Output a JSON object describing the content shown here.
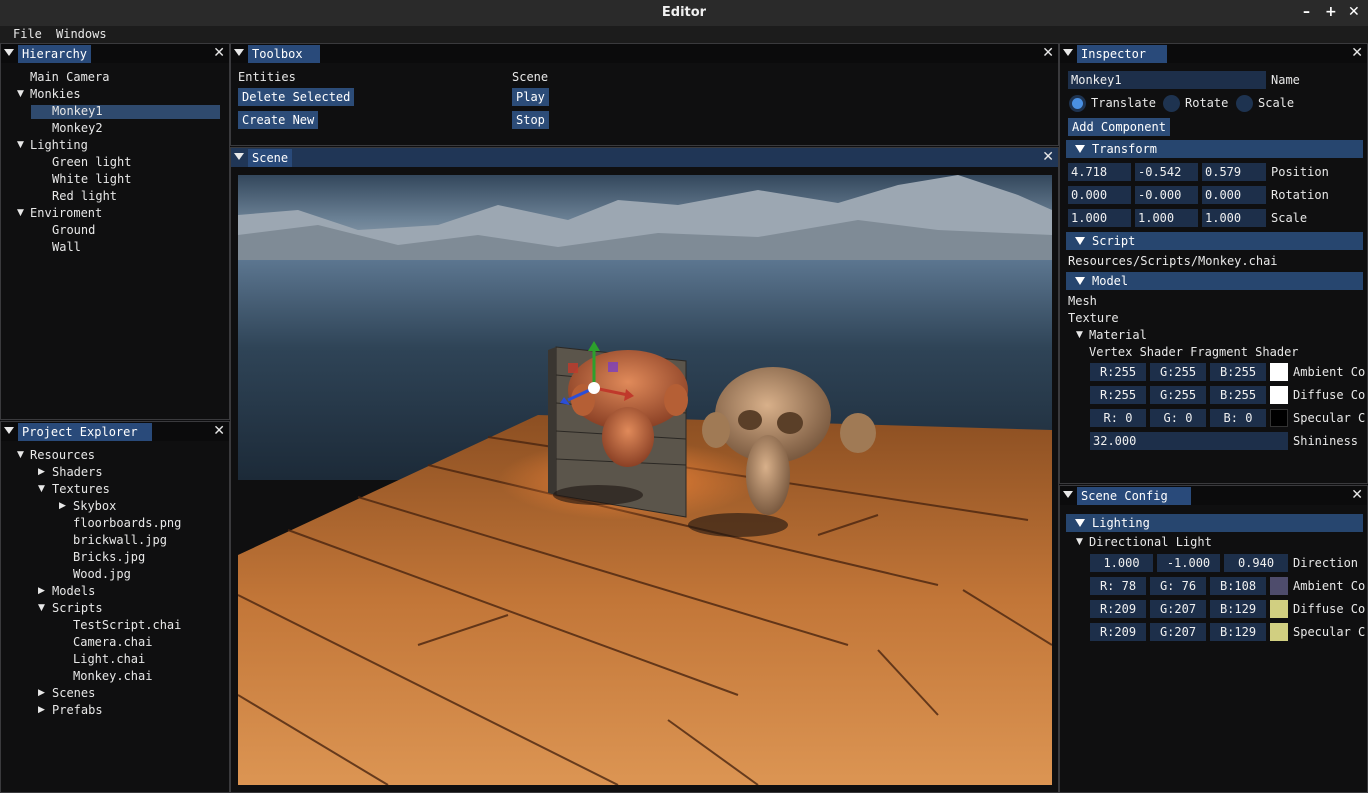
{
  "app": {
    "title": "Editor",
    "menu": [
      "File",
      "Windows"
    ]
  },
  "hierarchy": {
    "title": "Hierarchy",
    "items": [
      {
        "label": "Main Camera"
      },
      {
        "label": "Monkies"
      },
      {
        "label": "Monkey1"
      },
      {
        "label": "Monkey2"
      },
      {
        "label": "Lighting"
      },
      {
        "label": "Green light"
      },
      {
        "label": "White light"
      },
      {
        "label": "Red light"
      },
      {
        "label": "Enviroment"
      },
      {
        "label": "Ground"
      },
      {
        "label": "Wall"
      }
    ],
    "selected": "Monkey1"
  },
  "project": {
    "title": "Project Explorer",
    "items": [
      {
        "label": "Resources"
      },
      {
        "label": "Shaders"
      },
      {
        "label": "Textures"
      },
      {
        "label": "Skybox"
      },
      {
        "label": "floorboards.png"
      },
      {
        "label": "brickwall.jpg"
      },
      {
        "label": "Bricks.jpg"
      },
      {
        "label": "Wood.jpg"
      },
      {
        "label": "Models"
      },
      {
        "label": "Scripts"
      },
      {
        "label": "TestScript.chai"
      },
      {
        "label": "Camera.chai"
      },
      {
        "label": "Light.chai"
      },
      {
        "label": "Monkey.chai"
      },
      {
        "label": "Scenes"
      },
      {
        "label": "Prefabs"
      }
    ]
  },
  "toolbox": {
    "title": "Toolbox",
    "entities_label": "Entities",
    "delete_label": "Delete Selected",
    "create_label": "Create New",
    "scene_label": "Scene",
    "play_label": "Play",
    "stop_label": "Stop"
  },
  "scene": {
    "title": "Scene"
  },
  "inspector": {
    "title": "Inspector",
    "name_value": "Monkey1",
    "name_label": "Name",
    "modes": {
      "translate": "Translate",
      "rotate": "Rotate",
      "scale": "Scale",
      "selected": "Translate"
    },
    "add_component": "Add Component",
    "transform": {
      "header": "Transform",
      "position": {
        "label": "Position",
        "values": [
          "4.718",
          "-0.542",
          "0.579"
        ]
      },
      "rotation": {
        "label": "Rotation",
        "values": [
          "0.000",
          "-0.000",
          "0.000"
        ]
      },
      "scale": {
        "label": "Scale",
        "values": [
          "1.000",
          "1.000",
          "1.000"
        ]
      }
    },
    "script": {
      "header": "Script",
      "path": "Resources/Scripts/Monkey.chai"
    },
    "model": {
      "header": "Model",
      "mesh": "Mesh",
      "texture": "Texture",
      "material": "Material",
      "shaders": "Vertex Shader Fragment Shader",
      "ambient": {
        "r": "R:255",
        "g": "G:255",
        "b": "B:255",
        "label": "Ambient Co",
        "color": "#ffffff"
      },
      "diffuse": {
        "r": "R:255",
        "g": "G:255",
        "b": "B:255",
        "label": "Diffuse Co",
        "color": "#ffffff"
      },
      "specular": {
        "r": "R:  0",
        "g": "G:  0",
        "b": "B:  0",
        "label": "Specular C",
        "color": "#000000"
      },
      "shininess": {
        "value": "32.000",
        "label": "Shininess"
      }
    }
  },
  "scene_config": {
    "title": "Scene Config",
    "lighting_header": "Lighting",
    "directional": "Directional Light",
    "direction": {
      "values": [
        "1.000",
        "-1.000",
        "0.940"
      ],
      "label": "Direction"
    },
    "ambient": {
      "r": "R: 78",
      "g": "G: 76",
      "b": "B:108",
      "label": "Ambient Co",
      "color": "#4e4c6c"
    },
    "diffuse": {
      "r": "R:209",
      "g": "G:207",
      "b": "B:129",
      "label": "Diffuse Co",
      "color": "#d1cf81"
    },
    "specular": {
      "r": "R:209",
      "g": "G:207",
      "b": "B:129",
      "label": "Specular C",
      "color": "#d1cf81"
    }
  },
  "colors": {
    "accent": "#294a7a",
    "header": "#27466f",
    "field": "#1d2f4a"
  }
}
